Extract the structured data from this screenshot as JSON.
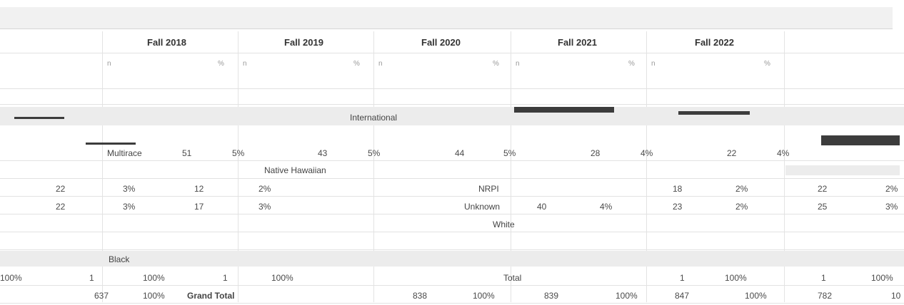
{
  "header": {
    "title": "",
    "years": [
      "Fall 2018",
      "Fall 2019",
      "Fall 2020",
      "Fall 2021",
      "Fall 2022"
    ],
    "sub_n": "n",
    "sub_pct": "%"
  },
  "rows": {
    "international": {
      "label": "International"
    },
    "multirace": {
      "label": "Multirace",
      "values": [
        "51",
        "5%",
        "43",
        "5%",
        "44",
        "5%",
        "28",
        "4%",
        "22",
        "4%"
      ]
    },
    "native_hawaiian": {
      "label": "Native Hawaiian"
    },
    "nrpi": {
      "label": "NRPI",
      "values": [
        "22",
        "3%",
        "12",
        "2%",
        "",
        "",
        "18",
        "2%",
        "22",
        "2%"
      ]
    },
    "unknown": {
      "label": "Unknown",
      "values": [
        "22",
        "3%",
        "17",
        "3%",
        "",
        "",
        "40",
        "4%",
        "23",
        "2%",
        "25",
        "3%"
      ]
    },
    "white": {
      "label": "White"
    },
    "black": {
      "label": "Black"
    },
    "total": {
      "label": "Total",
      "values": [
        "100%",
        "1",
        "100%",
        "1",
        "100%",
        "",
        "1",
        "100%",
        "1",
        "100%"
      ]
    },
    "grand_total": {
      "label": "Grand Total",
      "values": [
        "637",
        "100%",
        "838",
        "100%",
        "839",
        "100%",
        "847",
        "100%",
        "782",
        "10"
      ]
    }
  }
}
